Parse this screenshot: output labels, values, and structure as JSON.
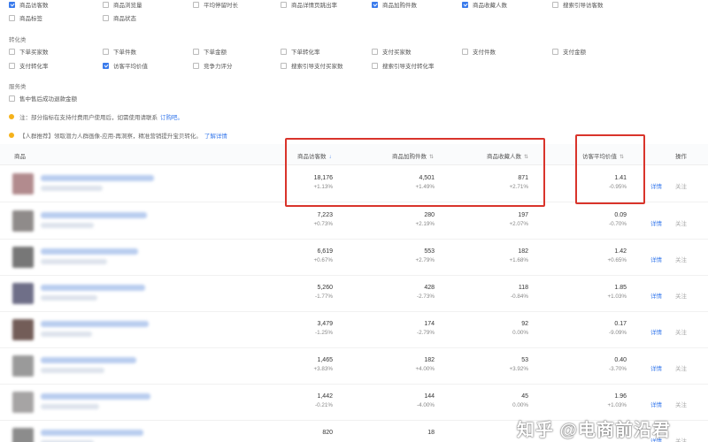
{
  "metric_rows": [
    {
      "items": [
        {
          "label": "商品访客数",
          "checked": true
        },
        {
          "label": "商品浏览量",
          "checked": false
        },
        {
          "label": "平均停留时长",
          "checked": false
        },
        {
          "label": "商品详情页跳出率",
          "checked": false
        },
        {
          "label": "商品加购件数",
          "checked": true
        },
        {
          "label": "商品收藏人数",
          "checked": true
        },
        {
          "label": "搜索引导访客数",
          "checked": false
        }
      ]
    },
    {
      "items": [
        {
          "label": "商品标签",
          "checked": false
        },
        {
          "label": "商品状态",
          "checked": false
        }
      ]
    }
  ],
  "groups": [
    {
      "title": "转化类",
      "rows": [
        [
          {
            "label": "下单买家数",
            "checked": false
          },
          {
            "label": "下单件数",
            "checked": false
          },
          {
            "label": "下单金额",
            "checked": false
          },
          {
            "label": "下单转化率",
            "checked": false
          },
          {
            "label": "支付买家数",
            "checked": false
          },
          {
            "label": "支付件数",
            "checked": false
          },
          {
            "label": "支付金额",
            "checked": false
          }
        ],
        [
          {
            "label": "支付转化率",
            "checked": false
          },
          {
            "label": "访客平均价值",
            "checked": true
          },
          {
            "label": "竞争力评分",
            "checked": false
          },
          {
            "label": "搜索引导支付买家数",
            "checked": false
          },
          {
            "label": "搜索引导支付转化率",
            "checked": false
          }
        ]
      ]
    },
    {
      "title": "服务类",
      "rows": [
        [
          {
            "label": "售中售后成功退款金额",
            "checked": false
          }
        ]
      ]
    }
  ],
  "notices": [
    {
      "text": "注：部分指标在支持付费用户使用后，如需使用请联系",
      "link": "订购吧。"
    },
    {
      "text": "【人群推荐】领取潜力人群画像-应用-再洞察，精准营销提升宝贝转化。",
      "link": "了解详情"
    }
  ],
  "table": {
    "headers": {
      "product": "商品",
      "visitors": "商品访客数",
      "cart": "商品加购件数",
      "fav": "商品收藏人数",
      "avg_value": "访客平均价值",
      "ops": "操作"
    },
    "sort_icon": "↓",
    "sort_neutral": "⇅",
    "detail_label": "详情",
    "follow_label": "关注",
    "rows": [
      {
        "visitors": "18,176",
        "visitors_chg": "+1.13%",
        "cart": "4,501",
        "cart_chg": "+1.49%",
        "fav": "871",
        "fav_chg": "+2.71%",
        "avg": "1.41",
        "avg_chg": "-0.95%",
        "thumb": "#b28b8e"
      },
      {
        "visitors": "7,223",
        "visitors_chg": "+0.73%",
        "cart": "280",
        "cart_chg": "+2.19%",
        "fav": "197",
        "fav_chg": "+2.07%",
        "avg": "0.09",
        "avg_chg": "-0.70%",
        "thumb": "#8f8b8a"
      },
      {
        "visitors": "6,619",
        "visitors_chg": "+0.67%",
        "cart": "553",
        "cart_chg": "+2.79%",
        "fav": "182",
        "fav_chg": "+1.68%",
        "avg": "1.42",
        "avg_chg": "+0.65%",
        "thumb": "#777777"
      },
      {
        "visitors": "5,260",
        "visitors_chg": "-1.77%",
        "cart": "428",
        "cart_chg": "-2.73%",
        "fav": "118",
        "fav_chg": "-0.84%",
        "avg": "1.85",
        "avg_chg": "+1.03%",
        "thumb": "#6f6f88"
      },
      {
        "visitors": "3,479",
        "visitors_chg": "-1.25%",
        "cart": "174",
        "cart_chg": "-2.79%",
        "fav": "92",
        "fav_chg": "0.00%",
        "avg": "0.17",
        "avg_chg": "-9.09%",
        "thumb": "#735d58"
      },
      {
        "visitors": "1,465",
        "visitors_chg": "+3.83%",
        "cart": "182",
        "cart_chg": "+4.00%",
        "fav": "53",
        "fav_chg": "+3.92%",
        "avg": "0.40",
        "avg_chg": "-3.70%",
        "thumb": "#9a9a9a"
      },
      {
        "visitors": "1,442",
        "visitors_chg": "-0.21%",
        "cart": "144",
        "cart_chg": "-4.00%",
        "fav": "45",
        "fav_chg": "0.00%",
        "avg": "1.96",
        "avg_chg": "+1.03%",
        "thumb": "#a6a4a4"
      },
      {
        "visitors": "820",
        "visitors_chg": "",
        "cart": "18",
        "cart_chg": "",
        "fav": "",
        "fav_chg": "",
        "avg": "",
        "avg_chg": "",
        "thumb": "#8c8c8c"
      }
    ]
  },
  "watermark": "知乎 @电商前沿君",
  "colors": {
    "accent": "#3a7bec",
    "highlight": "#d9342b",
    "notice_dot": "#f5b21b"
  }
}
